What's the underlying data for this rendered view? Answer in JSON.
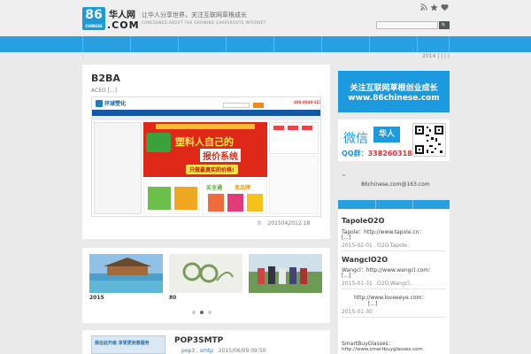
{
  "header": {
    "logo_number": "86",
    "logo_sub": "CHINESE",
    "site_name": "华人网",
    "site_com": ".COM",
    "slogan": "让华人分享世界，关注互联网草根成长",
    "slogan_en": "CONCERNED ABOUT THE GROWING GRASSROOTS INTERNET",
    "search_placeholder": "",
    "search_button": "🔍"
  },
  "icons": {
    "rss": "rss-icon",
    "star": "star-icon",
    "heart": "heart-icon",
    "search": "search-icon"
  },
  "crumb": {
    "left": ":",
    "right": "2014 | | | |"
  },
  "colors": {
    "accent": "#27a0e3",
    "banner": "#1b9ae0",
    "background": "#eaeaea"
  },
  "main_post": {
    "title": "B2BA",
    "excerpt": "ACEO [...]",
    "meta_count": "0",
    "meta_date": "2015042012:18",
    "img": {
      "brand": "环球塑化",
      "phone": "400-8049-123",
      "banner_big": "塑料人自己的",
      "banner_big2": "报价系统",
      "banner_sub": "只做最真实的价格!",
      "buy": "买全通",
      "sell": "卖品牌"
    }
  },
  "slider": {
    "items": [
      {
        "caption": "2015"
      },
      {
        "caption": "80"
      },
      {
        "caption": ""
      }
    ],
    "dots": 3,
    "active_dot": 1
  },
  "bottom_post": {
    "title": "POP3SMTP",
    "tag1": "pop3",
    "tag2": "smtp",
    "date": "2015/06/09 09:50",
    "thumb_text": "我在此升级 享受更完善服务"
  },
  "sidebar": {
    "banner_line1": "关注互联网草根创业成长",
    "banner_line2": "www.86chinese.com",
    "wechat_label": "微信",
    "wechat_brand": "华人",
    "qq_label": "QQ群：",
    "qq_number": "338260318",
    "dash": "~",
    "email": "86chinese.com@163.com",
    "items": [
      {
        "title": "TapoleO2O",
        "text": "Tapole：http://www.tapole.cn：",
        "more": "[...]",
        "date": "2015-02-01",
        "tag": "O2O.Tapole.."
      },
      {
        "title": "WangclO2O",
        "text": "Wangcl：http://www.wangcl.com：",
        "more": "[...]",
        "date": "2015-01-31",
        "tag": "O2O.Wangcl.."
      },
      {
        "title": "",
        "text": "http://www.loveeeye.com：",
        "more": "[...]",
        "date": "2015-01-30",
        "tag": ""
      },
      {
        "title": "",
        "text": "SmartBuyGlasses：",
        "more": "http://www.smartbuyglasses.com",
        "date": "",
        "tag": ""
      }
    ]
  }
}
